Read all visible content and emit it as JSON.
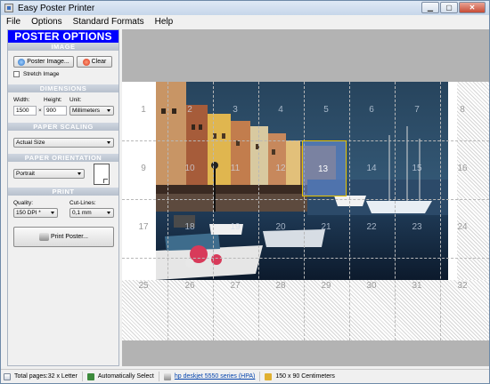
{
  "window": {
    "title": "Easy Poster Printer"
  },
  "menu": {
    "items": [
      "File",
      "Options",
      "Standard Formats",
      "Help"
    ]
  },
  "panel": {
    "title": "POSTER OPTIONS",
    "image": {
      "header": "IMAGE",
      "poster_button": "Poster Image...",
      "clear_button": "Clear",
      "stretch_label": "Stretch Image",
      "stretch_checked": false
    },
    "dimensions": {
      "header": "DIMENSIONS",
      "width_label": "Width:",
      "height_label": "Height:",
      "unit_label": "Unit:",
      "width_value": "1500",
      "times": "×",
      "height_value": "900",
      "unit_value": "Millimeters"
    },
    "scaling": {
      "header": "PAPER SCALING",
      "value": "Actual Size"
    },
    "orientation": {
      "header": "PAPER ORIENTATION",
      "value": "Portrait"
    },
    "print": {
      "header": "PRINT",
      "quality_label": "Quality:",
      "quality_value": "150 DPI *",
      "cutlines_label": "Cut-Lines:",
      "cutlines_value": "0,1 mm",
      "print_button": "Print Poster..."
    }
  },
  "canvas": {
    "page_numbers": [
      "1",
      "2",
      "3",
      "4",
      "5",
      "6",
      "7",
      "8",
      "9",
      "10",
      "11",
      "12",
      "13",
      "14",
      "15",
      "16",
      "17",
      "18",
      "19",
      "20",
      "21",
      "22",
      "23",
      "24",
      "25",
      "26",
      "27",
      "28",
      "29",
      "30",
      "31",
      "32"
    ],
    "selected_page": "13"
  },
  "status": {
    "total_pages": "Total pages:32 x Letter",
    "auto_select": "Automatically Select",
    "printer": "hp deskjet 5550 series (HPA)",
    "size": "150 x 90 Centimeters"
  },
  "colors": {
    "panel_title_bg": "#0000ff",
    "selected_tile": "#6e96e6",
    "link": "#0645ad"
  }
}
